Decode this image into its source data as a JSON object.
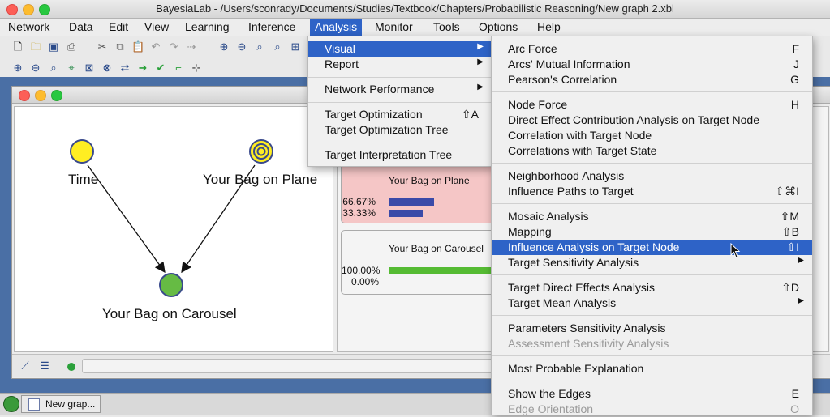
{
  "window": {
    "title": "BayesiaLab - /Users/sconrady/Documents/Studies/Textbook/Chapters/Probabilistic Reasoning/New graph 2.xbl"
  },
  "menubar": {
    "items": [
      "Network",
      "Data",
      "Edit",
      "View",
      "Learning",
      "Inference",
      "Analysis",
      "Monitor",
      "Tools",
      "Options",
      "Help"
    ],
    "active": "Analysis"
  },
  "analysis_menu": {
    "items": [
      {
        "label": "Visual",
        "shortcut": "",
        "submenu": true,
        "highlighted": true
      },
      {
        "label": "Report",
        "shortcut": "",
        "submenu": true
      },
      {
        "label": "Network Performance",
        "shortcut": "",
        "submenu": true
      },
      {
        "label": "Target Optimization",
        "shortcut": "⇧A",
        "submenu": false
      },
      {
        "label": "Target Optimization Tree",
        "shortcut": "",
        "submenu": false
      },
      {
        "label": "Target Interpretation Tree",
        "shortcut": "",
        "submenu": false
      }
    ]
  },
  "visual_submenu": {
    "items": [
      {
        "label": "Arc Force",
        "shortcut": "F"
      },
      {
        "label": "Arcs' Mutual Information",
        "shortcut": "J"
      },
      {
        "label": "Pearson's Correlation",
        "shortcut": "G"
      },
      {
        "label": "Node Force",
        "shortcut": "H"
      },
      {
        "label": "Direct Effect Contribution Analysis on Target Node",
        "shortcut": ""
      },
      {
        "label": "Correlation with Target Node",
        "shortcut": ""
      },
      {
        "label": "Correlations with Target State",
        "shortcut": ""
      },
      {
        "label": "Neighborhood Analysis",
        "shortcut": ""
      },
      {
        "label": "Influence Paths to Target",
        "shortcut": "⇧⌘I"
      },
      {
        "label": "Mosaic Analysis",
        "shortcut": "⇧M"
      },
      {
        "label": "Mapping",
        "shortcut": "⇧B"
      },
      {
        "label": "Influence Analysis on Target Node",
        "shortcut": "⇧I",
        "highlighted": true
      },
      {
        "label": "Target Sensitivity Analysis",
        "shortcut": "",
        "submenu": true
      },
      {
        "label": "Target Direct Effects Analysis",
        "shortcut": "⇧D"
      },
      {
        "label": "Target Mean Analysis",
        "shortcut": "",
        "submenu": true
      },
      {
        "label": "Parameters Sensitivity Analysis",
        "shortcut": ""
      },
      {
        "label": "Assessment Sensitivity Analysis",
        "shortcut": "",
        "disabled": true
      },
      {
        "label": "Most Probable Explanation",
        "shortcut": ""
      },
      {
        "label": "Show the Edges",
        "shortcut": "E"
      },
      {
        "label": "Edge Orientation",
        "shortcut": "O",
        "disabled": true
      }
    ]
  },
  "graph": {
    "nodes": [
      {
        "label": "Time",
        "color": "#ffee22"
      },
      {
        "label": "Your Bag on Plane",
        "color": "#ffee22"
      },
      {
        "label": "Your Bag on Carousel",
        "color": "#66bb44"
      }
    ]
  },
  "monitors": [
    {
      "title": "Your Bag on Plane",
      "bg": "#f5c6c6",
      "rows": [
        {
          "pct": "66.67%",
          "value": 0.6667,
          "color": "#3a4aa8"
        },
        {
          "pct": "33.33%",
          "value": 0.3333,
          "color": "#3a4aa8"
        }
      ]
    },
    {
      "title": "Your Bag on Carousel",
      "bg": "#f4f4f4",
      "rows": [
        {
          "pct": "100.00%",
          "value": 1.0,
          "color": "#55bb33"
        },
        {
          "pct": "0.00%",
          "value": 0.0,
          "color": "#55bb33"
        }
      ]
    }
  ],
  "taskbar": {
    "item": "New grap..."
  },
  "colors": {
    "menu_highlight": "#2e63c7",
    "desktop": "#4a6fa5"
  }
}
